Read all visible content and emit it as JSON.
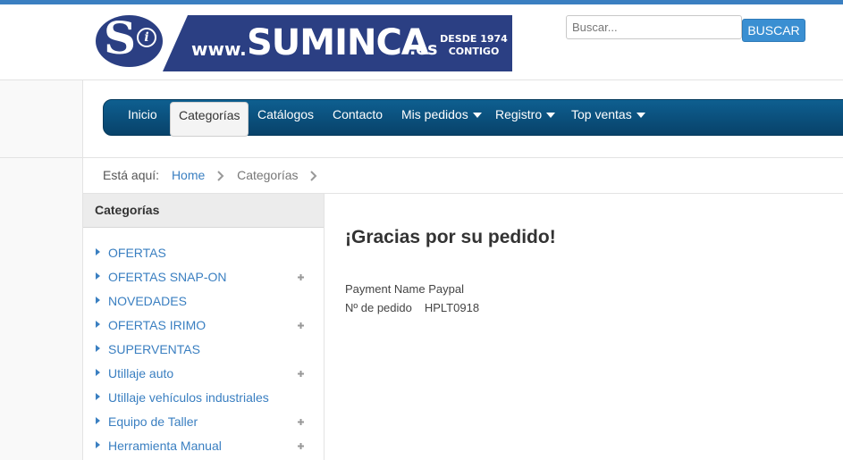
{
  "brand": {
    "logo_mark": "S",
    "logo_info": "i",
    "www": "www.",
    "name": "SUMINCA",
    "tld": ".es",
    "tagline_1": "DESDE 1974",
    "tagline_2": "CONTIGO",
    "colors": {
      "primary": "#2b3f83",
      "accent": "#3a7fc1"
    }
  },
  "search": {
    "placeholder": "Buscar...",
    "value": "",
    "button_label": "BUSCAR"
  },
  "nav": {
    "items": [
      {
        "label": "Inicio",
        "active": false,
        "dropdown": false
      },
      {
        "label": "Categorías",
        "active": true,
        "dropdown": false
      },
      {
        "label": "Catálogos",
        "active": false,
        "dropdown": false
      },
      {
        "label": "Contacto",
        "active": false,
        "dropdown": false
      },
      {
        "label": "Mis pedidos",
        "active": false,
        "dropdown": true
      },
      {
        "label": "Registro",
        "active": false,
        "dropdown": true
      },
      {
        "label": "Top ventas",
        "active": false,
        "dropdown": true
      }
    ]
  },
  "breadcrumb": {
    "label": "Está aquí:",
    "home": "Home",
    "current": "Categorías"
  },
  "sidebar": {
    "title": "Categorías",
    "items": [
      {
        "label": "OFERTAS",
        "expandable": false
      },
      {
        "label": "OFERTAS SNAP-ON",
        "expandable": true
      },
      {
        "label": "NOVEDADES",
        "expandable": false
      },
      {
        "label": "OFERTAS IRIMO",
        "expandable": true
      },
      {
        "label": "SUPERVENTAS",
        "expandable": false
      },
      {
        "label": "Utillaje auto",
        "expandable": true
      },
      {
        "label": "Utillaje vehículos industriales",
        "expandable": false
      },
      {
        "label": "Equipo de Taller",
        "expandable": true
      },
      {
        "label": "Herramienta Manual",
        "expandable": true
      }
    ]
  },
  "content": {
    "title": "¡Gracias por su pedido!",
    "payment_line": "Payment Name Paypal",
    "order_label": "Nº de pedido",
    "order_number": "HPLT0918"
  }
}
